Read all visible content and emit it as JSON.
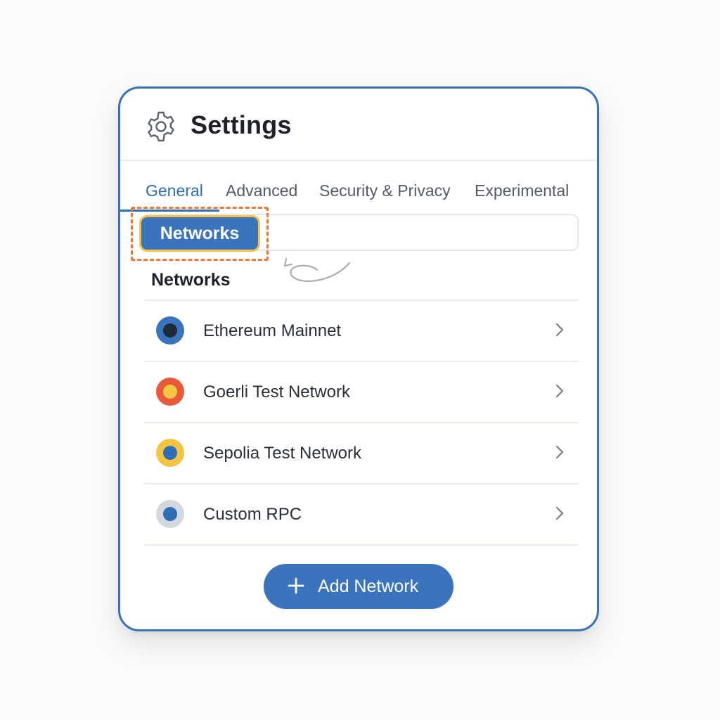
{
  "header": {
    "title": "Settings",
    "icon": "gear-icon"
  },
  "tabs": [
    {
      "label": "General",
      "active": true
    },
    {
      "label": "Advanced",
      "active": false
    },
    {
      "label": "Security & Privacy",
      "active": false
    },
    {
      "label": "Experimental",
      "active": false
    }
  ],
  "search": {
    "chip_label": "Networks"
  },
  "section": {
    "title": "Networks"
  },
  "networks": [
    {
      "label": "Ethereum Mainnet",
      "outer_color": "#3a74bc",
      "inner_color": "#1f2a3a"
    },
    {
      "label": "Goerli Test Network",
      "outer_color": "#e8593a",
      "inner_color": "#f4c542"
    },
    {
      "label": "Sepolia Test Network",
      "outer_color": "#f4c542",
      "inner_color": "#2f6eb5"
    },
    {
      "label": "Custom RPC",
      "outer_color": "#d3d7de",
      "inner_color": "#2f6eb5"
    }
  ],
  "add_button": {
    "label": "Add Network"
  },
  "colors": {
    "accent": "#3a74bc",
    "highlight_border": "#f4c542",
    "annotation_outline": "#ef7a2f"
  }
}
